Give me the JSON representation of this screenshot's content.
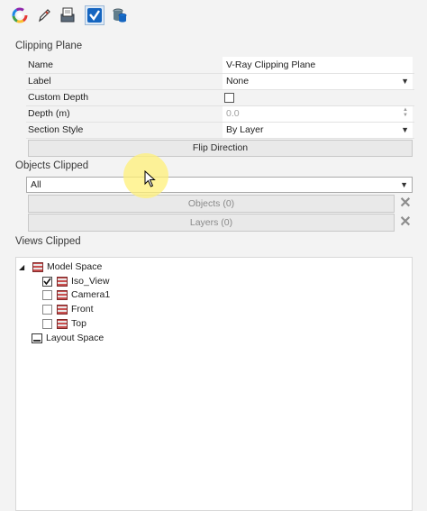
{
  "toolbar": {
    "icons": [
      "color-wheel-icon",
      "pencil-icon",
      "document-scanner-icon",
      "vray-icon",
      "layers-icon"
    ],
    "active_index": 3
  },
  "clipping_plane": {
    "title": "Clipping Plane",
    "rows": {
      "name": {
        "label": "Name",
        "value": "V-Ray Clipping Plane"
      },
      "label": {
        "label": "Label",
        "value": "None"
      },
      "custom_depth": {
        "label": "Custom Depth",
        "checked": false
      },
      "depth": {
        "label": "Depth (m)",
        "value": "0.0"
      },
      "section_style": {
        "label": "Section Style",
        "value": "By Layer"
      }
    },
    "flip_button": "Flip Direction"
  },
  "objects_clipped": {
    "title": "Objects Clipped",
    "filter_value": "All",
    "objects_button": "Objects (0)",
    "layers_button": "Layers (0)"
  },
  "views_clipped": {
    "title": "Views Clipped",
    "model_space": "Model Space",
    "views": [
      {
        "label": "Iso_View",
        "checked": true
      },
      {
        "label": "Camera1",
        "checked": false
      },
      {
        "label": "Front",
        "checked": false
      },
      {
        "label": "Top",
        "checked": false
      }
    ],
    "layout_space": "Layout Space"
  }
}
